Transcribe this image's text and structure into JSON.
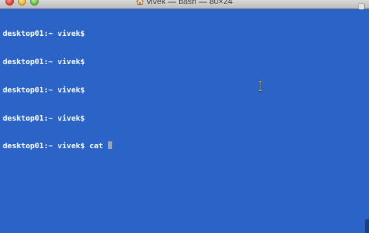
{
  "window": {
    "title": "vivek — bash — 80×24",
    "title_icon": "home-icon"
  },
  "terminal": {
    "background_color": "#2b64c6",
    "text_color": "#ffffff",
    "lines": [
      "desktop01:~ vivek$",
      "desktop01:~ vivek$",
      "desktop01:~ vivek$",
      "desktop01:~ vivek$",
      "desktop01:~ vivek$ cat "
    ]
  }
}
